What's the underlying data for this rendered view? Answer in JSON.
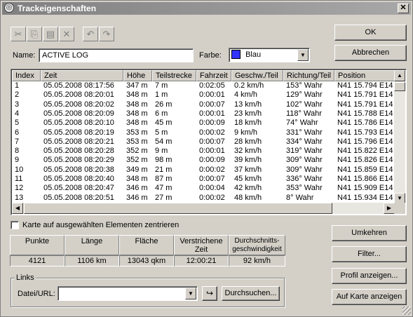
{
  "window": {
    "title": "Trackeigenschaften",
    "close_label": "✕"
  },
  "toolbar": [
    "cut-icon",
    "copy-icon",
    "paste-icon",
    "delete-icon",
    "undo-icon",
    "redo-icon"
  ],
  "name": {
    "label": "Name:",
    "value": "ACTIVE LOG"
  },
  "farbe": {
    "label": "Farbe:",
    "value": "Blau",
    "swatch": "#3333ff"
  },
  "buttons": {
    "ok": "OK",
    "abbrechen": "Abbrechen",
    "umkehren": "Umkehren",
    "filter": "Filter...",
    "profil": "Profil anzeigen...",
    "karte": "Auf Karte anzeigen"
  },
  "table": {
    "headers": [
      "Index",
      "Zeit",
      "Höhe",
      "Teilstrecke",
      "Fahrzeit",
      "Geschw./Teil",
      "Richtung/Teil",
      "Position"
    ],
    "rows": [
      [
        "1",
        "05.05.2008 08:17:56",
        "347 m",
        "7 m",
        "0:02:05",
        "0.2 km/h",
        "153° Wahr",
        "N41 15.794 E14 5"
      ],
      [
        "2",
        "05.05.2008 08:20:01",
        "348 m",
        "1 m",
        "0:00:01",
        "4 km/h",
        "129° Wahr",
        "N41 15.791 E14 5"
      ],
      [
        "3",
        "05.05.2008 08:20:02",
        "348 m",
        "26 m",
        "0:00:07",
        "13 km/h",
        "102° Wahr",
        "N41 15.791 E14 5"
      ],
      [
        "4",
        "05.05.2008 08:20:09",
        "348 m",
        "6 m",
        "0:00:01",
        "23 km/h",
        "118° Wahr",
        "N41 15.788 E14 5"
      ],
      [
        "5",
        "05.05.2008 08:20:10",
        "348 m",
        "45 m",
        "0:00:09",
        "18 km/h",
        "74° Wahr",
        "N41 15.786 E14 5"
      ],
      [
        "6",
        "05.05.2008 08:20:19",
        "353 m",
        "5 m",
        "0:00:02",
        "9 km/h",
        "331° Wahr",
        "N41 15.793 E14 5"
      ],
      [
        "7",
        "05.05.2008 08:20:21",
        "353 m",
        "54 m",
        "0:00:07",
        "28 km/h",
        "334° Wahr",
        "N41 15.796 E14 5"
      ],
      [
        "8",
        "05.05.2008 08:20:28",
        "352 m",
        "9 m",
        "0:00:01",
        "32 km/h",
        "319° Wahr",
        "N41 15.822 E14 5"
      ],
      [
        "9",
        "05.05.2008 08:20:29",
        "352 m",
        "98 m",
        "0:00:09",
        "39 km/h",
        "309° Wahr",
        "N41 15.826 E14 5"
      ],
      [
        "10",
        "05.05.2008 08:20:38",
        "349 m",
        "21 m",
        "0:00:02",
        "37 km/h",
        "309° Wahr",
        "N41 15.859 E14 5"
      ],
      [
        "11",
        "05.05.2008 08:20:40",
        "348 m",
        "87 m",
        "0:00:07",
        "45 km/h",
        "336° Wahr",
        "N41 15.866 E14 5"
      ],
      [
        "12",
        "05.05.2008 08:20:47",
        "346 m",
        "47 m",
        "0:00:04",
        "42 km/h",
        "353° Wahr",
        "N41 15.909 E14 5"
      ],
      [
        "13",
        "05.05.2008 08:20:51",
        "346 m",
        "27 m",
        "0:00:02",
        "48 km/h",
        "8° Wahr",
        "N41 15.934 E14 5"
      ]
    ]
  },
  "checkbox_label": "Karte auf ausgewählten Elementen zentrieren",
  "stats": {
    "headers": [
      "Punkte",
      "Länge",
      "Fläche",
      "Verstrichene Zeit",
      "Durchschnitts-geschwindigkeit"
    ],
    "values": [
      "4121",
      "1106 km",
      "13043 qkm",
      "12:00:21",
      "92 km/h"
    ]
  },
  "links": {
    "group_label": "Links",
    "datei_label": "Datei/URL:",
    "datei_value": "",
    "browse": "Durchsuchen..."
  }
}
